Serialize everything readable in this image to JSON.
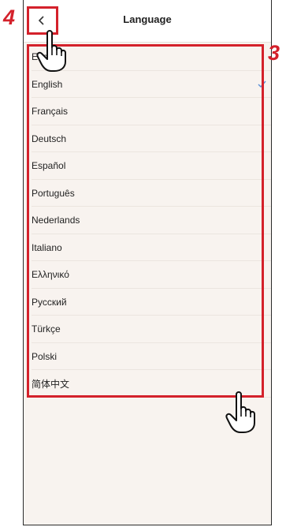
{
  "header": {
    "title": "Language"
  },
  "annotations": {
    "step_back": "4",
    "step_list": "3"
  },
  "languages": [
    {
      "label": "Español",
      "selected": false
    },
    {
      "label": "English",
      "selected": true
    },
    {
      "label": "Français",
      "selected": false
    },
    {
      "label": "Deutsch",
      "selected": false
    },
    {
      "label": "Español",
      "selected": false
    },
    {
      "label": "Português",
      "selected": false
    },
    {
      "label": "Nederlands",
      "selected": false
    },
    {
      "label": "Italiano",
      "selected": false
    },
    {
      "label": "Ελληνικό",
      "selected": false
    },
    {
      "label": "Русский",
      "selected": false
    },
    {
      "label": "Türkçe",
      "selected": false
    },
    {
      "label": "Polski",
      "selected": false
    },
    {
      "label": "简体中文",
      "selected": false
    }
  ],
  "colors": {
    "accent_check": "#5b8fd6",
    "annotation_red": "#d4212b",
    "background": "#f8f3ef"
  },
  "icons": {
    "back": "chevron-left-icon",
    "check": "checkmark-icon",
    "pointer": "pointing-hand-icon"
  }
}
